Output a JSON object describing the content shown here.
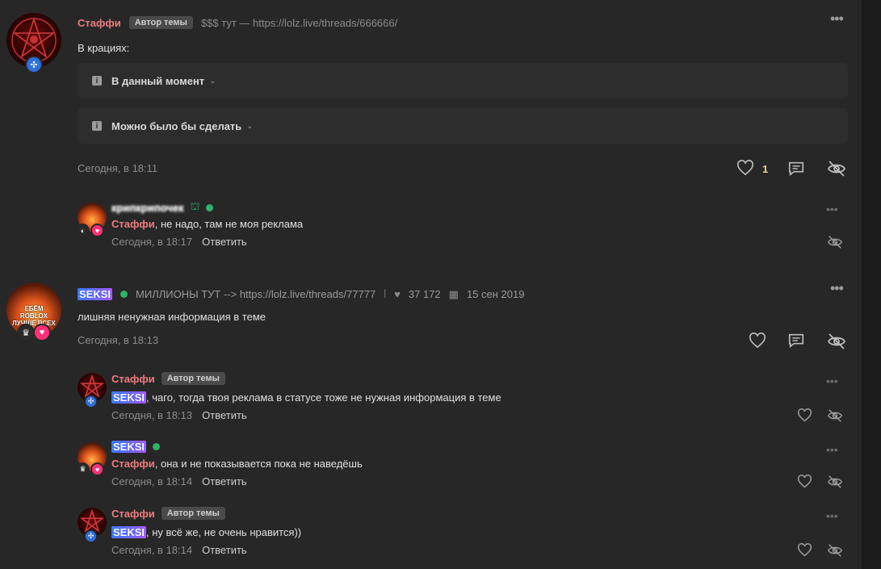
{
  "post1": {
    "author": "Стаффи",
    "author_tag": "Автор темы",
    "status": "$$$ тут — https://lolz.live/threads/666666/",
    "body": "В крациях:",
    "spoilers": [
      {
        "label": "В данный момент"
      },
      {
        "label": "Можно было бы сделать"
      }
    ],
    "time": "Сегодня, в 18:11",
    "likes": "1"
  },
  "comment1": {
    "author": "крипкрипочек",
    "mention": "Стаффи",
    "text": ", не надо, там не моя реклама",
    "time": "Сегодня, в 18:17",
    "reply_label": "Ответить"
  },
  "post2": {
    "author": "SEKSI",
    "status": "МИЛЛИОНЫ ТУТ --> https://lolz.live/threads/77777",
    "likes_count": "37 172",
    "reg_date": "15 сен 2019",
    "body": "лишняя ненужная информация в теме",
    "time": "Сегодня, в 18:13",
    "avatar_text": "ЕБЁМ ROBLOX ЛУЧШЕ ВСЕХ"
  },
  "comments": [
    {
      "author": "Стаффи",
      "author_tag": "Автор темы",
      "mention": "SEKSI",
      "text": ", чаго, тогда твоя реклама в статусе тоже не нужная информация в теме",
      "time": "Сегодня, в 18:13",
      "reply_label": "Ответить"
    },
    {
      "author": "SEKSI",
      "mention": "Стаффи",
      "text": ", она и не показывается пока не наведёшь",
      "time": "Сегодня, в 18:14",
      "reply_label": "Ответить"
    },
    {
      "author": "Стаффи",
      "author_tag": "Автор темы",
      "mention": "SEKSI",
      "text": ", ну всё же, не очень нравится))",
      "time": "Сегодня, в 18:14",
      "reply_label": "Ответить"
    }
  ],
  "icons": {
    "more": "more-dots-icon",
    "like": "heart-icon",
    "comment": "comment-icon",
    "hide": "eye-off-icon",
    "info": "info-icon",
    "chevron": "chevron-down-icon"
  },
  "colors": {
    "background": "#272727",
    "author_red": "#f07c7c",
    "online": "#2fb36a",
    "like_count": "#e8d98a"
  }
}
